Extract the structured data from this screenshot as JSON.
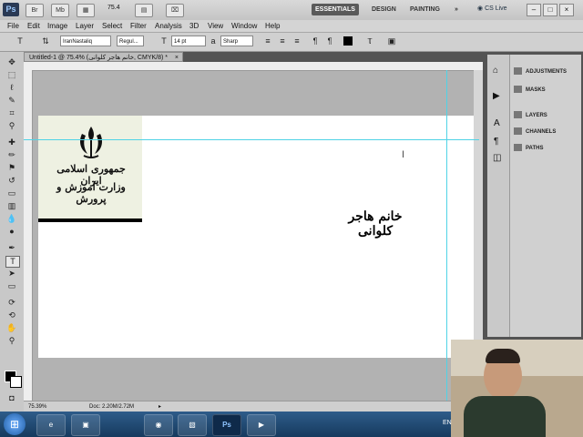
{
  "app": {
    "logo": "Ps",
    "zoom_value": "75.4",
    "workspaces": [
      "ESSENTIALS",
      "DESIGN",
      "PAINTING"
    ],
    "more": "»",
    "cs_live": "CS Live"
  },
  "menu": [
    "File",
    "Edit",
    "Image",
    "Layer",
    "Select",
    "Filter",
    "Analysis",
    "3D",
    "View",
    "Window",
    "Help"
  ],
  "options": {
    "font_family": "IranNastaliq",
    "font_style": "Regul...",
    "font_size": "14 pt",
    "antialias": "Sharp"
  },
  "document": {
    "tab_title": "Untitled-1 @ 75.4% (خانم هاجر کلوانی, CMYK/8) *",
    "logo_line1": "جمهوری اسلامی ایران",
    "logo_line2": "وزارت آموزش و پرورش",
    "canvas_text": "خانم هاجر کلوانی",
    "zoom_status": "75.39%",
    "doc_status": "Doc: 2.20M/2.72M"
  },
  "panels": [
    "ADJUSTMENTS",
    "MASKS",
    "LAYERS",
    "CHANNELS",
    "PATHS"
  ],
  "taskbar": {
    "start": "⊞",
    "items": [
      "e",
      "▣",
      "◉",
      "▧",
      "Ps",
      "▶"
    ],
    "lang": "EN"
  },
  "colors": {
    "guide": "#4fd3e6",
    "workspace_active": "#5a5a5a",
    "taskbar": "#1f4a73"
  }
}
